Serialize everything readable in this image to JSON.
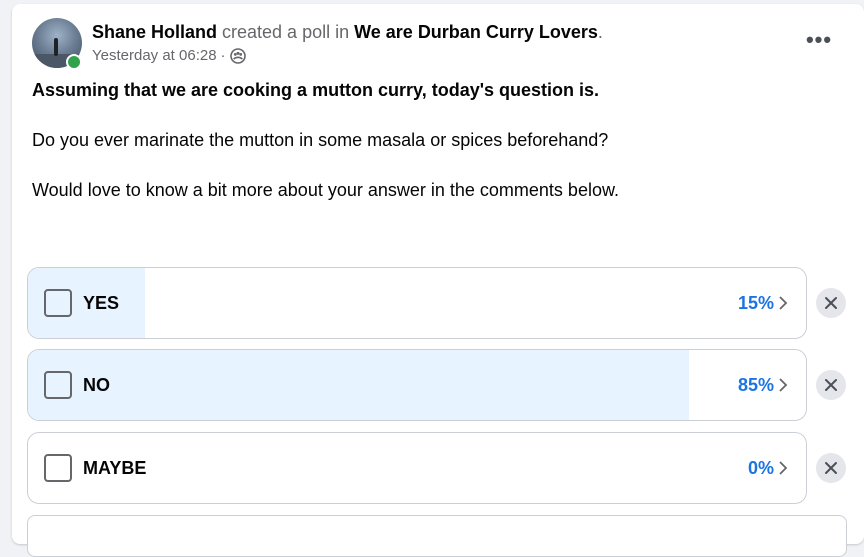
{
  "post": {
    "author": "Shane Holland",
    "action": " created a poll in ",
    "group": "We are Durban Curry Lovers",
    "group_suffix": ".",
    "timestamp": "Yesterday at 06:28",
    "separator": " · ",
    "audience_icon": "group-audience-icon",
    "more_icon": "more-options-icon",
    "more_label": "•••",
    "text_lines": [
      "Assuming that we are cooking a mutton curry, today's question is.",
      "Do you ever marinate the mutton in some masala or spices beforehand?",
      "Would love to know a bit more about your answer in the comments below."
    ]
  },
  "poll": {
    "options": [
      {
        "label": "YES",
        "percent_label": "15%",
        "percent": 15
      },
      {
        "label": "NO",
        "percent_label": "85%",
        "percent": 85
      },
      {
        "label": "MAYBE",
        "percent_label": "0%",
        "percent": 0
      }
    ]
  },
  "colors": {
    "accent": "#1b74e4",
    "fill": "#e7f3ff",
    "online": "#31a24c"
  }
}
